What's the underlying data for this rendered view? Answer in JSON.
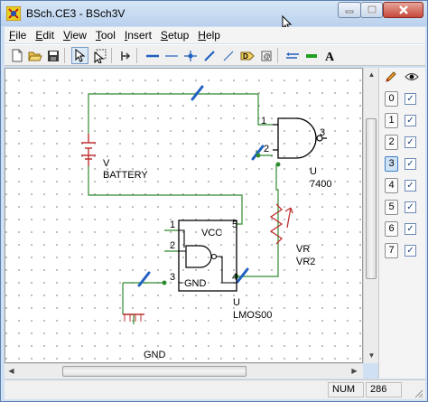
{
  "window": {
    "title": "BSch.CE3 - BSch3V",
    "brand_color": "#e8d020"
  },
  "menu": [
    {
      "key": "F",
      "rest": "ile"
    },
    {
      "key": "E",
      "rest": "dit"
    },
    {
      "key": "V",
      "rest": "iew"
    },
    {
      "key": "T",
      "rest": "ool"
    },
    {
      "key": "I",
      "rest": "nsert"
    },
    {
      "key": "S",
      "rest": "etup"
    },
    {
      "key": "H",
      "rest": "elp"
    }
  ],
  "toolbar": {
    "icons": [
      "new-file-icon",
      "open-file-icon",
      "save-icon",
      "select-pointer-icon",
      "drag-select-icon",
      "place-component-icon",
      "wire-icon",
      "bus-icon",
      "junction-icon",
      "entry-icon",
      "dashed-line-icon",
      "tag-icon",
      "comment-icon",
      "label-icon",
      "small-line-icon",
      "text-icon"
    ]
  },
  "schematic": {
    "battery": {
      "ref": "V",
      "name": "BATTERY"
    },
    "nand": {
      "ref": "U",
      "name": "7400",
      "pin1": "1",
      "pin2": "2",
      "pin3": "3"
    },
    "ic": {
      "vcc": "VCC",
      "gnd": "GND",
      "ref": "U",
      "name": "LMOS00",
      "pin1": "1",
      "pin2": "2",
      "pin3": "3",
      "pin4": "4",
      "pin5": "5"
    },
    "resistor": {
      "ref": "VR",
      "name": "VR2"
    },
    "ground_label": "GND",
    "wire_color": "#2e8b2e",
    "part_color": "#c03030",
    "entry_color": "#2060c0"
  },
  "layers": {
    "items": [
      "0",
      "1",
      "2",
      "3",
      "4",
      "5",
      "6",
      "7"
    ],
    "active": "3",
    "check_mark": "✓"
  },
  "status": {
    "num": "NUM",
    "value": "286"
  }
}
